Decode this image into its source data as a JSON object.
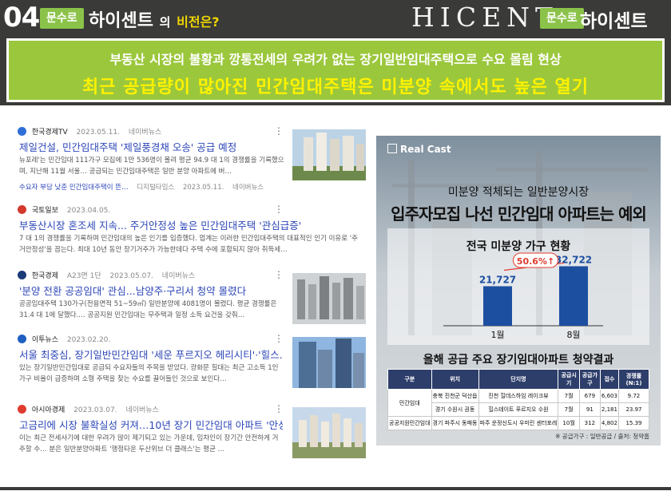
{
  "header": {
    "number": "04",
    "badge_left": "문수로",
    "title_main": "하이센트",
    "title_small": "의",
    "title_accent": "비전은?",
    "logo_text": "HICENT",
    "badge_right": "문수로",
    "brand_name": "하이센트",
    "banner_line1": "부동산 시장의 불황과 깡통전세의 우려가 없는 장기일반임대주택으로 수요 몰림 현상",
    "banner_line2": "최근 공급량이 많아진 민간임대주택은 미분양 속에서도 높은 열기"
  },
  "news": [
    {
      "source": "한국경제TV",
      "date": "2023.05.11.",
      "portal": "네이버뉴스",
      "title": "제일건설, 민간임대주택 '제일풍경채 오송' 공급 예정",
      "snippet": "뉴포레'는 민간임대 111가구 모집에 1만 536명이 몰려 평균 94.9 대 1의 경쟁률을 기록했으며, 지난해 11월 서울… 공급되는 민간임대주택은 일반 분양 아파트에 버…",
      "sub_title": "수요자 부담 낮춘 민간임대주택이 뜬…",
      "sub_source": "디지털타임스",
      "sub_date": "2023.05.11.",
      "sub_portal": "네이버뉴스",
      "logo_color": "#2f6fd8"
    },
    {
      "source": "국토일보",
      "date": "2023.04.05.",
      "portal": "",
      "title": "부동산시장 혼조세 지속... 주거안정성 높은 민간임대주택 '관심급증'",
      "snippet": "7 대 1의 경쟁률을 기록하며 민간임대의 높은 인기를 입증했다. 업계는 이러한 민간임대주택의 대표적인 인기 이유로 '주거안정성'을 꼽는다. 최대 10년 동안 장기거주가 가능한데다 주택 수에 포함되지 않아 취득세…",
      "logo_color": "#d33a2c"
    },
    {
      "source": "한국경제",
      "date": "2023.05.07.",
      "portal": "네이버뉴스",
      "paper": "A23면 1단",
      "title": "'분양 전환 공공임대' 관심...남양주·구리서 청약 몰렸다",
      "snippet": "공공임대주택 130가구(전용면적 51~59㎡) 일반분양에 4081명이 몰렸다. 평균 경쟁률은 31.4 대 1에 달했다.… 공공지원 민간임대는 무주택과 일정 소득 요건을 갖춰…",
      "logo_color": "#1b3a78"
    },
    {
      "source": "이투뉴스",
      "date": "2023.02.20.",
      "portal": "",
      "title": "서울 최중심, 장기일반민간임대 '세운 푸르지오 헤리시티'·'힐스…",
      "snippet": "있는 장기일반민간임대로 공급되 수요자들의 주목을 받았다. 광화문 힐대는 최근 고소득 1인 가구 비율이 급증하며 소형 주택을 찾는 수요를 끌어들인 것으로 보인다…",
      "logo_color": "#1f5fbf"
    },
    {
      "source": "아시아경제",
      "date": "2023.03.07.",
      "portal": "네이버뉴스",
      "title": "고금리에 시장 불확실성 커져…10년 장기 민간임대 아파트 '안성…",
      "snippet": "이는 최근 전세사기에 대한 우려가 많이 제기되고 있는 가운데, 임차인이 장기간 안전하게 거주할 수… 분은 일반분양아파트 '행정타운 두산위브 더 클래스'는 평균 …",
      "logo_color": "#e03b2f"
    }
  ],
  "infographic": {
    "brand": "Real Cast",
    "subtitle": "미분양 적체되는 일반분양시장",
    "headline": "입주자모집 나선 민간임대 아파트는 예외",
    "table_title": "올해 공급 주요 장기임대아파트 청약결과",
    "note": "※ 공급가구 : 일반공급 / 출처: 청약홈"
  },
  "chart_data": {
    "type": "bar",
    "title": "전국 미분양 가구 현황",
    "categories": [
      "1월",
      "8월"
    ],
    "values": [
      21727,
      32722
    ],
    "value_labels": [
      "21,727",
      "32,722"
    ],
    "annotation": "50.6%↑",
    "ylim": [
      0,
      36000
    ],
    "bar_color": "#1d4fa0"
  },
  "table": {
    "headers": [
      "구분",
      "위치",
      "단지명",
      "공급시기",
      "공급가구",
      "접수",
      "경쟁률(N:1)"
    ],
    "rows": [
      [
        "민간임대",
        "충북 진천군 덕산읍",
        "진천 힐데스하임 레이크뷰",
        "7월",
        "679",
        "6,603",
        "9.72"
      ],
      [
        "민간임대",
        "경기 수원시 권동",
        "힐스테이트 푸르지오 수원",
        "7월",
        "91",
        "2,181",
        "23.97"
      ],
      [
        "공공지원민간임대",
        "경기 파주시 동패동",
        "파주 운정신도시 우미린 센터포레",
        "10월",
        "312",
        "4,802",
        "15.39"
      ]
    ],
    "group_labels": [
      "민간임대",
      "공공지원민간임대"
    ]
  },
  "colors": {
    "header_bg": "#3a3a38",
    "banner_green": "#9bc73c",
    "banner_yellow_text": "#fff200",
    "badge_green": "#8bc34a",
    "link_blue": "#2c46b8"
  }
}
